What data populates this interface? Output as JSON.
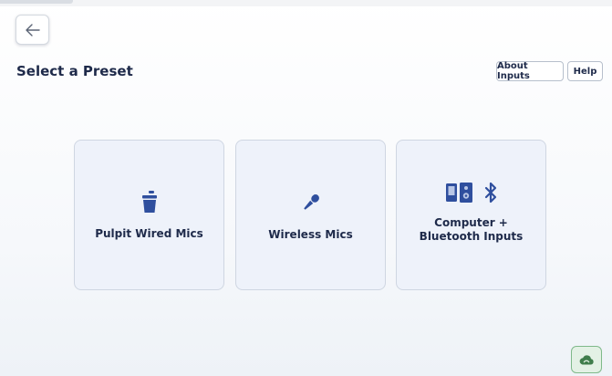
{
  "header": {
    "title": "Select a Preset",
    "about_label": "About Inputs",
    "help_label": "Help"
  },
  "presets": [
    {
      "label": "Pulpit Wired Mics",
      "icon": "podium-icon"
    },
    {
      "label": "Wireless Mics",
      "icon": "microphone-icon"
    },
    {
      "label": "Computer +\nBluetooth Inputs",
      "icons": [
        "computer-icon",
        "bluetooth-icon"
      ]
    }
  ],
  "status": {
    "icon": "cloud-icon",
    "color": "#3f7d4b"
  },
  "colors": {
    "text": "#1e2a4a",
    "card_bg": "#eef2fa",
    "accent": "#2f4f9e"
  }
}
